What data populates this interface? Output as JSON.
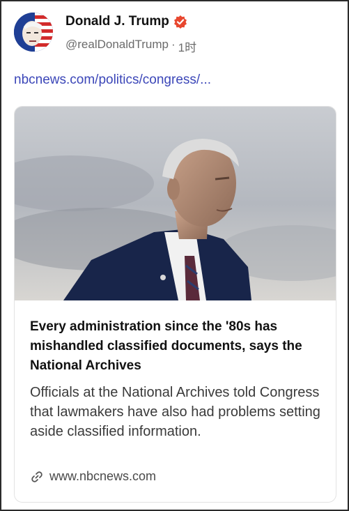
{
  "post": {
    "display_name": "Donald J. Trump",
    "handle": "@realDonaldTrump",
    "separator": "·",
    "time": "1时",
    "link_text": "nbcnews.com/politics/congress/..."
  },
  "card": {
    "title": "Every administration since the '80s has mishandled classified documents, says the National Archives",
    "description": "Officials at the National Archives told Congress that lawmakers have also had problems setting aside classified information.",
    "domain": "www.nbcnews.com"
  },
  "icons": {
    "verified": "verified-badge-icon",
    "link": "link-chain-icon"
  },
  "colors": {
    "link": "#3b46b8",
    "verified_badge": "#e8472f"
  }
}
